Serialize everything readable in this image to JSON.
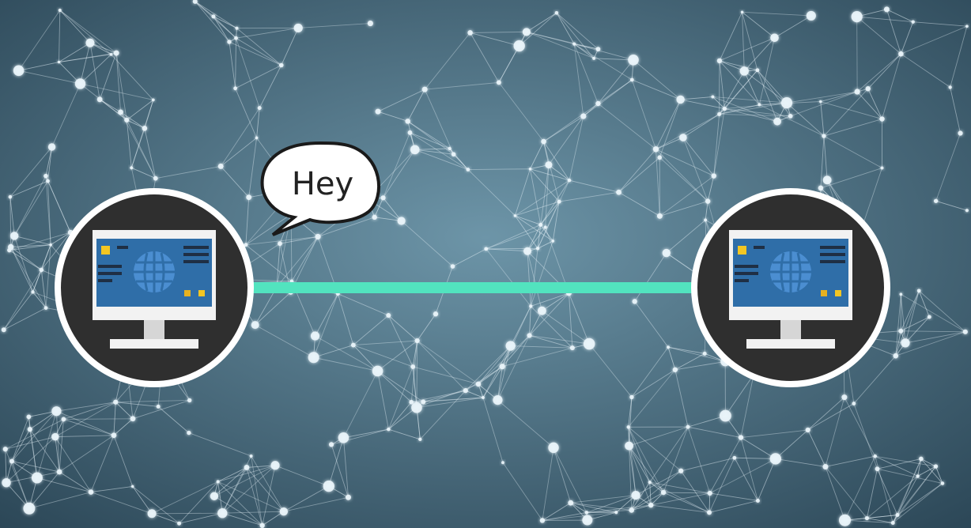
{
  "colors": {
    "background_center": "#6d95a8",
    "background_edge": "#2b4656",
    "network": "#e9f4fa",
    "link": "#52e3bf",
    "node_circle": "#2f2f2f",
    "node_ring": "#ffffff",
    "screen": "#2f6ea8",
    "monitor_frame": "#f2f2f2",
    "monitor_stand": "#d6d6d6",
    "screen_accent": "#f3c623",
    "screen_lines": "#1f2f45",
    "globe": "#4b8ed1"
  },
  "icons": [
    "computer-icon",
    "globe-icon",
    "speech-bubble"
  ],
  "speech_bubble": {
    "text": "Hey"
  }
}
